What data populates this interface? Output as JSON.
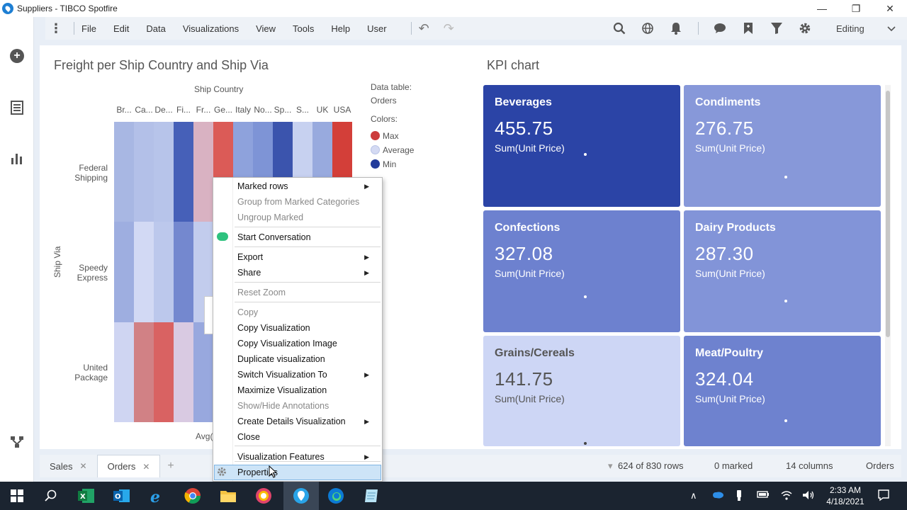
{
  "window": {
    "title": "Suppliers - TIBCO Spotfire",
    "minimize": "—",
    "maximize": "❐",
    "close": "✕"
  },
  "menubar": {
    "items": [
      "File",
      "Edit",
      "Data",
      "Visualizations",
      "View",
      "Tools",
      "Help",
      "User"
    ],
    "mode": "Editing"
  },
  "heatmap": {
    "title": "Freight per Ship Country and Ship Via",
    "x_axis_title": "Ship Country",
    "y_axis_title": "Ship Via",
    "bottom_label": "Avg(",
    "columns": [
      "Br...",
      "Ca...",
      "De...",
      "Fi...",
      "Fr...",
      "Ge...",
      "Italy",
      "No...",
      "Sp...",
      "S...",
      "UK",
      "USA"
    ],
    "rows": [
      {
        "label_line1": "Federal",
        "label_line2": "Shipping"
      },
      {
        "label_line1": "Speedy",
        "label_line2": "Express"
      },
      {
        "label_line1": "United",
        "label_line2": "Package"
      }
    ],
    "cell_colors": [
      [
        "#a8b7e3",
        "#b3c0e8",
        "#b7c4ea",
        "#4660b8",
        "#d9b2c2",
        "#db5b57",
        "#8ea2dc",
        "#7e94d6",
        "#3b54ad",
        "#c7d1f0",
        "#98aade",
        "#d33f39"
      ],
      [
        "#9eaee0",
        "#d2d9f4",
        "#bcc8ec",
        "#7488cf",
        "#c2cced",
        "#a0b0e1",
        "#a0b0e1",
        "#a0b0e1",
        "#a0b0e1",
        "#a0b0e1",
        "#a0b0e1",
        "#a0b0e1"
      ],
      [
        "#cfd5f2",
        "#d18185",
        "#d96262",
        "#d9cae2",
        "#98a8de",
        "#98a8de",
        "#98a8de",
        "#98a8de",
        "#98a8de",
        "#98a8de",
        "#98a8de",
        "#98a8de"
      ]
    ],
    "legend": {
      "data_table_label": "Data table:",
      "data_table_value": "Orders",
      "colors_label": "Colors:",
      "entries": [
        {
          "label": "Max",
          "color": "#cc3b3b"
        },
        {
          "label": "Average",
          "color": "#d4daf3"
        },
        {
          "label": "Min",
          "color": "#233c9b"
        }
      ]
    }
  },
  "kpi": {
    "title": "KPI chart",
    "tiles": [
      {
        "name": "Beverages",
        "value": "455.75",
        "measure": "Sum(Unit Price)",
        "color": "#2b44a6"
      },
      {
        "name": "Condiments",
        "value": "276.75",
        "measure": "Sum(Unit Price)",
        "color": "#8798d9"
      },
      {
        "name": "Confections",
        "value": "327.08",
        "measure": "Sum(Unit Price)",
        "color": "#6d81cf"
      },
      {
        "name": "Dairy Products",
        "value": "287.30",
        "measure": "Sum(Unit Price)",
        "color": "#8294d8"
      },
      {
        "name": "Grains/Cereals",
        "value": "141.75",
        "measure": "Sum(Unit Price)",
        "color": "#cdd6f5",
        "text_color": "#555"
      },
      {
        "name": "Meat/Poultry",
        "value": "324.04",
        "measure": "Sum(Unit Price)",
        "color": "#6e82cf"
      }
    ]
  },
  "context_menu": {
    "items": [
      {
        "label": "Marked rows",
        "submenu": true,
        "disabled": false
      },
      {
        "label": "Group from Marked Categories",
        "submenu": false,
        "disabled": true
      },
      {
        "label": "Ungroup Marked",
        "submenu": false,
        "disabled": true
      },
      {
        "label": "Start Conversation",
        "submenu": false,
        "disabled": false
      },
      {
        "label": "Export",
        "submenu": true,
        "disabled": false
      },
      {
        "label": "Share",
        "submenu": true,
        "disabled": false
      },
      {
        "label": "Reset Zoom",
        "submenu": false,
        "disabled": true
      },
      {
        "label": "Copy",
        "submenu": false,
        "disabled": true
      },
      {
        "label": "Copy Visualization",
        "submenu": false,
        "disabled": false
      },
      {
        "label": "Copy Visualization Image",
        "submenu": false,
        "disabled": false
      },
      {
        "label": "Duplicate visualization",
        "submenu": false,
        "disabled": false
      },
      {
        "label": "Switch Visualization To",
        "submenu": true,
        "disabled": false
      },
      {
        "label": "Maximize Visualization",
        "submenu": false,
        "disabled": false
      },
      {
        "label": "Show/Hide Annotations",
        "submenu": false,
        "disabled": true
      },
      {
        "label": "Create Details Visualization",
        "submenu": true,
        "disabled": false
      },
      {
        "label": "Close",
        "submenu": false,
        "disabled": false
      },
      {
        "label": "Visualization Features",
        "submenu": true,
        "disabled": false
      },
      {
        "label": "Properties",
        "submenu": false,
        "disabled": false
      }
    ]
  },
  "tabs": [
    {
      "label": "Sales",
      "active": false
    },
    {
      "label": "Orders",
      "active": true
    }
  ],
  "tab_add": "+",
  "tab_close": "✕",
  "status": {
    "rows": "624 of 830 rows",
    "marked": "0 marked",
    "columns": "14 columns",
    "table": "Orders"
  },
  "taskbar": {
    "time": "2:33 AM",
    "date": "4/18/2021"
  }
}
